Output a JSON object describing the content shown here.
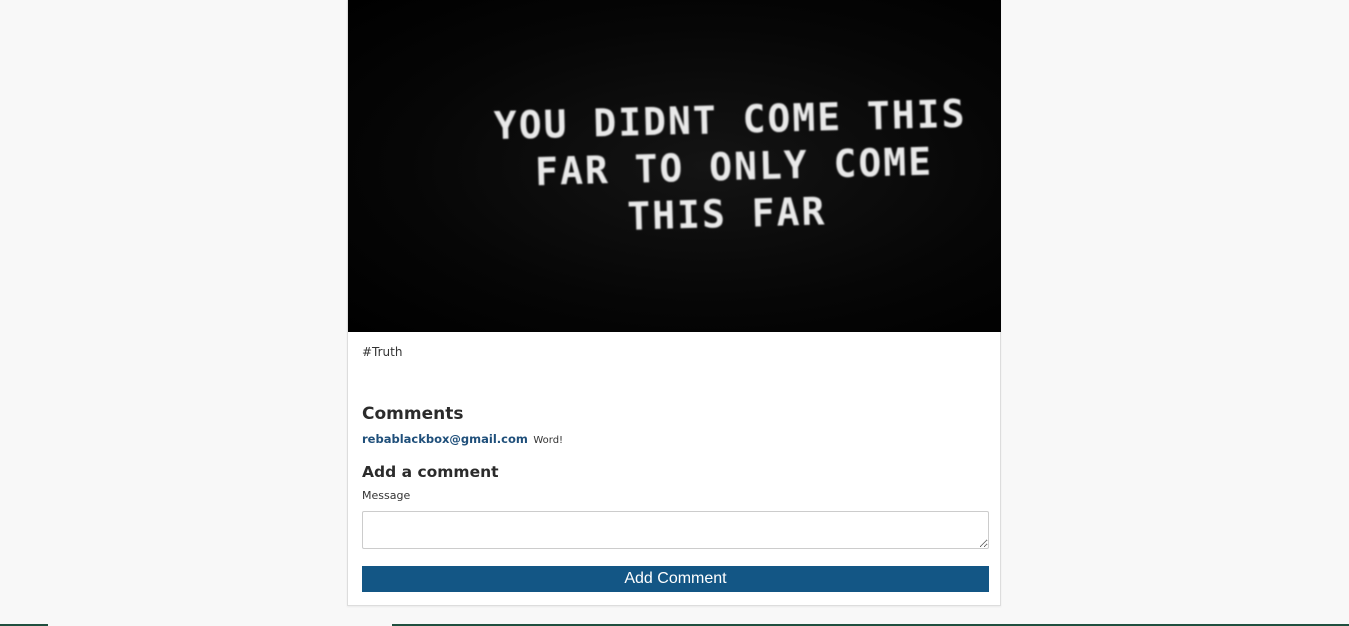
{
  "post": {
    "image_text_line1": "YOU DIDNT COME THIS",
    "image_text_line2": "FAR TO ONLY COME",
    "image_text_line3": "THIS FAR",
    "tag": "#Truth"
  },
  "comments": {
    "heading": "Comments",
    "items": [
      {
        "author": "rebablackbox@gmail.com",
        "text": "Word!"
      }
    ]
  },
  "add_comment": {
    "heading": "Add a comment",
    "message_label": "Message",
    "message_value": "",
    "submit_label": "Add Comment"
  },
  "colors": {
    "accent": "#135685",
    "link": "#1f4f7a",
    "background": "#f8f8f8"
  }
}
